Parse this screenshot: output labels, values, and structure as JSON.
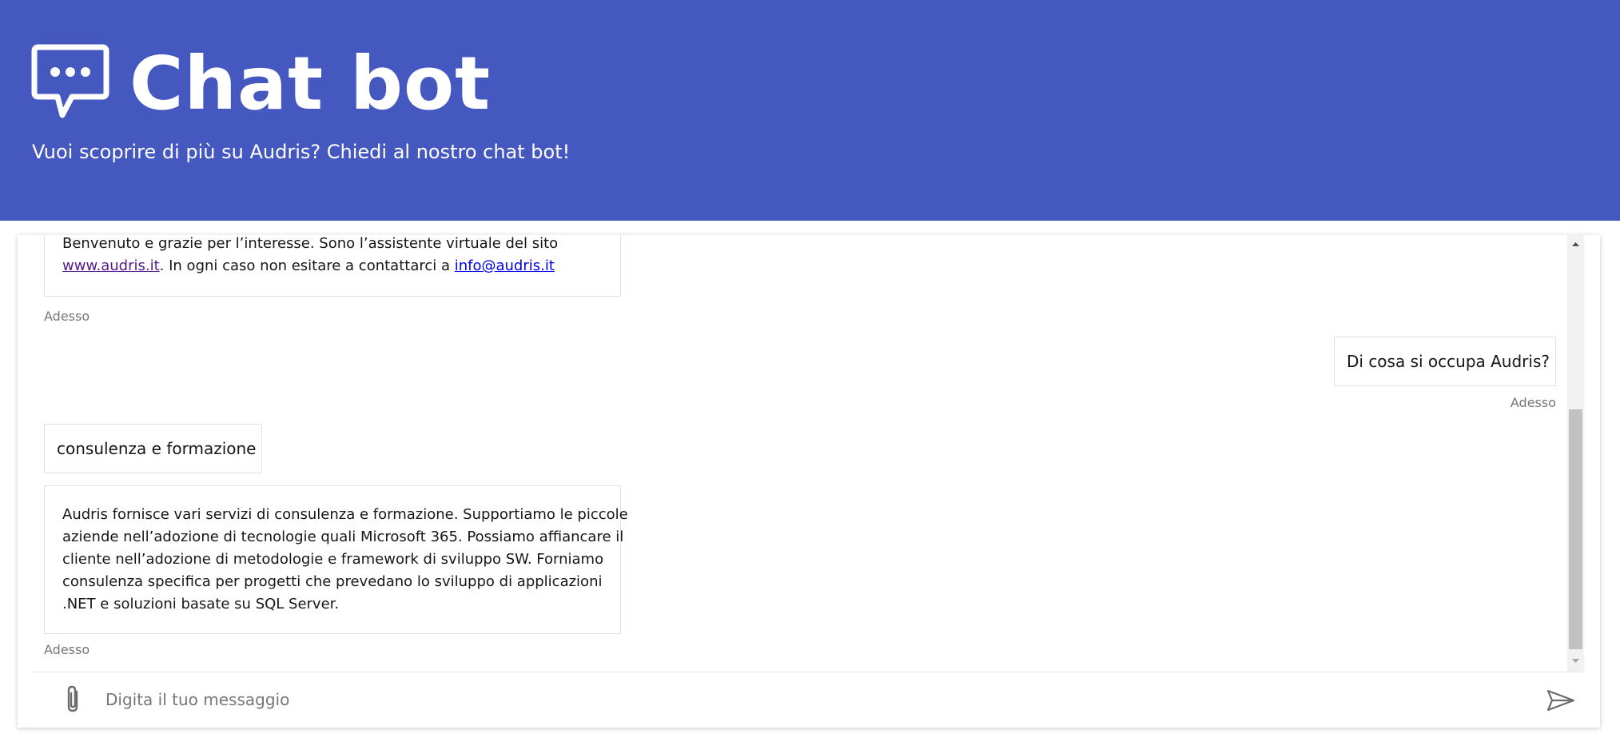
{
  "header": {
    "title": "Chat bot",
    "subtitle": "Vuoi scoprire di più su Audris? Chiedi al nostro chat bot!",
    "icon": "chat-bubble-icon",
    "background_color": "#4458bf"
  },
  "transcript": {
    "messages": [
      {
        "from": "bot",
        "type": "card",
        "line1": "Benvenuto e grazie per l’interesse.   Sono l’assistente virtuale del sito",
        "link_site": "www.audris.it",
        "middle_text": ".  In ogni caso non esitare a contattarci a ",
        "link_email": "info@audris.it",
        "timestamp": "Adesso"
      },
      {
        "from": "user",
        "text": "Di cosa si occupa Audris?",
        "timestamp": "Adesso"
      },
      {
        "from": "bot",
        "text": "consulenza e formazione"
      },
      {
        "from": "bot",
        "type": "card",
        "lines": [
          "Audris fornisce vari servizi di consulenza e formazione. Supportiamo le piccole",
          "aziende nell’adozione di tecnologie quali Microsoft 365. Possiamo affiancare il",
          "cliente nell’adozione di metodologie e framework di sviluppo SW. Forniamo",
          "consulenza specifica per progetti che prevedano lo sviluppo di applicazioni",
          ".NET e soluzioni basate su SQL Server."
        ],
        "timestamp": "Adesso"
      }
    ]
  },
  "input": {
    "placeholder": "Digita il tuo messaggio",
    "attach_icon": "paperclip-icon",
    "send_icon": "send-icon"
  },
  "colors": {
    "accent": "#4458bf",
    "link": "#0000ee",
    "link_visited": "#551a8b",
    "timestamp": "#767676"
  }
}
